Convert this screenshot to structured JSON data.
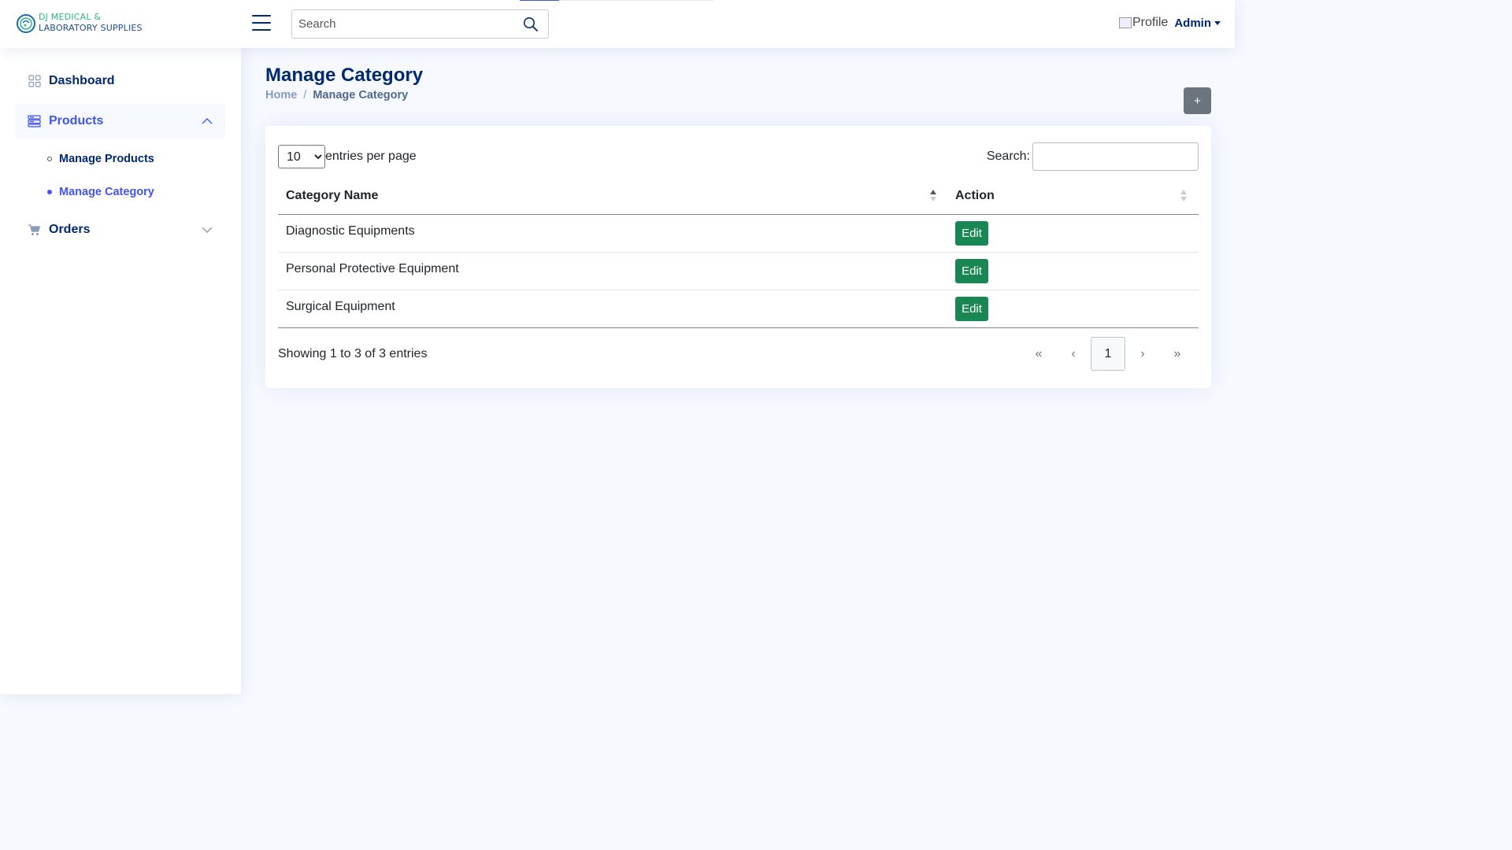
{
  "brand": {
    "line1": "DJ MEDICAL &",
    "line2": "LABORATORY SUPPLIES"
  },
  "header": {
    "search_placeholder": "Search",
    "profile_alt": "Profile",
    "user_name": "Admin"
  },
  "sidebar": {
    "items": [
      {
        "label": "Dashboard",
        "icon": "grid-icon"
      },
      {
        "label": "Products",
        "icon": "menu-button-icon",
        "expanded": true
      },
      {
        "label": "Orders",
        "icon": "cart-icon",
        "expanded": false
      }
    ],
    "products_sub": [
      {
        "label": "Manage Products"
      },
      {
        "label": "Manage Category"
      }
    ]
  },
  "page": {
    "title": "Manage Category",
    "breadcrumb": {
      "home": "Home",
      "separator": "/",
      "current": "Manage Category"
    },
    "add_button": "+"
  },
  "table": {
    "per_page_value": "10",
    "per_page_options": [
      "10"
    ],
    "per_page_label": "entries per page",
    "search_label": "Search:",
    "columns": [
      "Category Name",
      "Action"
    ],
    "rows": [
      {
        "name": "Diagnostic Equipments",
        "action": "Edit"
      },
      {
        "name": "Personal Protective Equipment",
        "action": "Edit"
      },
      {
        "name": "Surgical Equipment",
        "action": "Edit"
      }
    ],
    "info": "Showing 1 to 3 of 3 entries",
    "pagination": {
      "first": "«",
      "prev": "‹",
      "current": "1",
      "next": "›",
      "last": "»"
    }
  },
  "colors": {
    "primary_text": "#012970",
    "accent": "#4154f1",
    "edit_button": "#198754",
    "add_button": "#6c757d",
    "page_bg": "#f6f9ff"
  }
}
